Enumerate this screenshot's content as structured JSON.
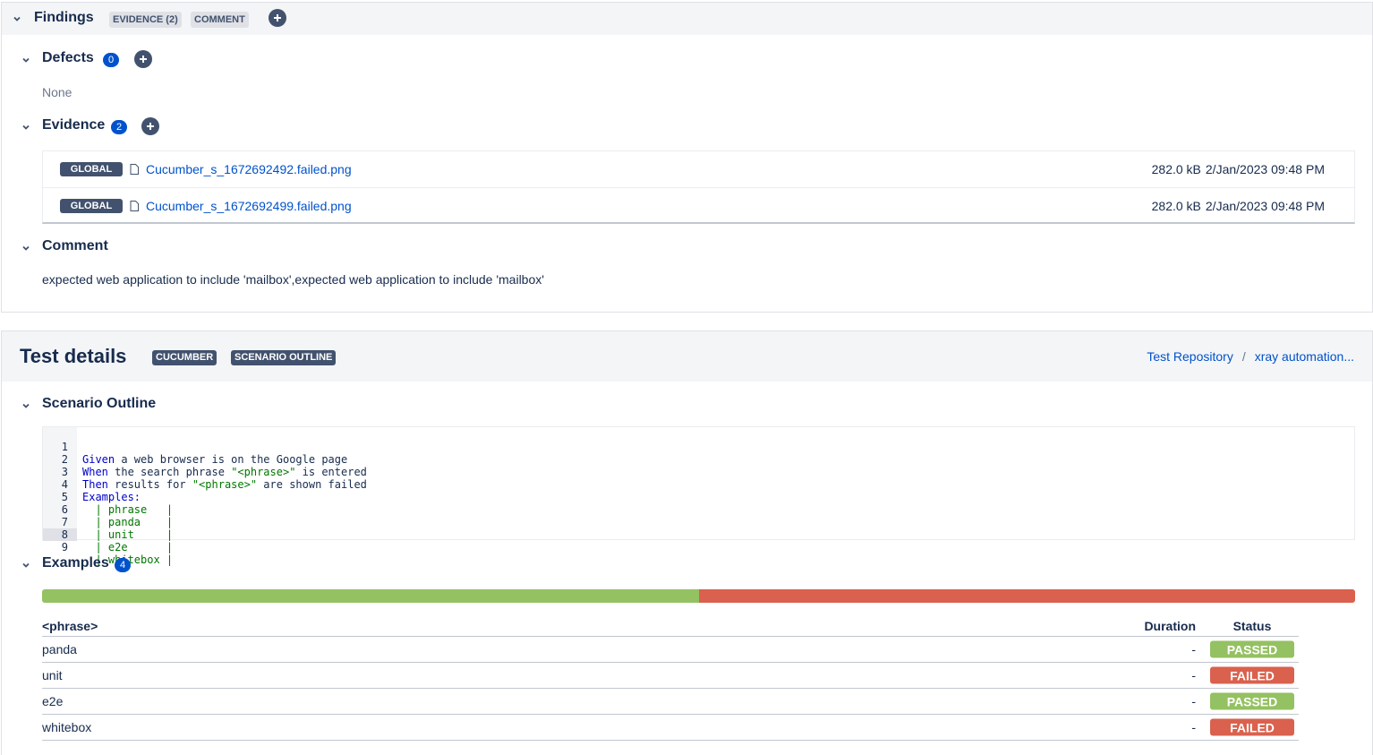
{
  "colors": {
    "accent": "#0052cc",
    "dark_lozenge": "#42526e",
    "passed": "#94c161",
    "failed": "#d9614e",
    "header_band": "#f4f5f7"
  },
  "findings": {
    "title": "Findings",
    "tab_evidence": "EVIDENCE (2)",
    "tab_comment": "COMMENT",
    "defects": {
      "title": "Defects",
      "count": "0",
      "empty": "None"
    },
    "evidence": {
      "title": "Evidence",
      "count": "2",
      "items": [
        {
          "scope": "GLOBAL",
          "file": "Cucumber_s_1672692492.failed.png",
          "size": "282.0 kB",
          "date": "2/Jan/2023 09:48 PM"
        },
        {
          "scope": "GLOBAL",
          "file": "Cucumber_s_1672692499.failed.png",
          "size": "282.0 kB",
          "date": "2/Jan/2023 09:48 PM"
        }
      ]
    },
    "comment": {
      "title": "Comment",
      "text": "expected web application to include 'mailbox',expected web application to include 'mailbox'"
    }
  },
  "test_details": {
    "title": "Test details",
    "tag_cucumber": "CUCUMBER",
    "tag_scenario": "SCENARIO OUTLINE",
    "breadcrumb": {
      "repo": "Test Repository",
      "separator": "/",
      "folder": "xray automation..."
    },
    "scenario_outline": {
      "title": "Scenario Outline",
      "lines": [
        {
          "no": "1",
          "kw": "Given",
          "rest": " a web browser is on the Google page"
        },
        {
          "no": "2",
          "kw": "When",
          "rest": " the search phrase ",
          "str": "\"<phrase>\"",
          "tail": " is entered"
        },
        {
          "no": "3",
          "kw": "Then",
          "rest": " results for ",
          "str": "\"<phrase>\"",
          "tail": " are shown failed"
        },
        {
          "no": "4",
          "kw": "Examples:",
          "rest": ""
        },
        {
          "no": "5",
          "table": "  | phrase   |"
        },
        {
          "no": "6",
          "table": "  | panda    |"
        },
        {
          "no": "7",
          "table": "  | unit     |"
        },
        {
          "no": "8",
          "table": "  | e2e      |"
        },
        {
          "no": "9",
          "table": "  | whitebox |"
        }
      ]
    },
    "examples": {
      "title": "Examples",
      "count": "4",
      "passed_fraction": 0.5,
      "columns": {
        "phrase": "<phrase>",
        "duration": "Duration",
        "status": "Status"
      },
      "rows": [
        {
          "phrase": "panda",
          "duration": "-",
          "status": "PASSED"
        },
        {
          "phrase": "unit",
          "duration": "-",
          "status": "FAILED"
        },
        {
          "phrase": "e2e",
          "duration": "-",
          "status": "PASSED"
        },
        {
          "phrase": "whitebox",
          "duration": "-",
          "status": "FAILED"
        }
      ]
    }
  }
}
